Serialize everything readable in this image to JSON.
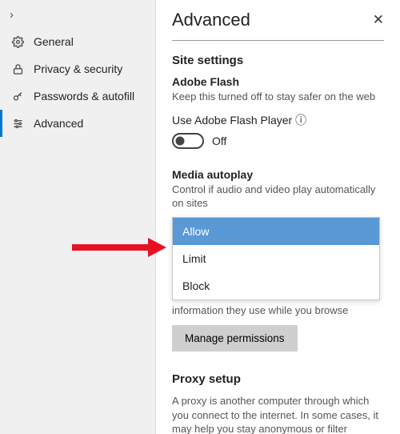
{
  "sidebar": {
    "chevron": "›",
    "items": [
      {
        "label": "General",
        "icon": "gear"
      },
      {
        "label": "Privacy & security",
        "icon": "lock"
      },
      {
        "label": "Passwords & autofill",
        "icon": "key"
      },
      {
        "label": "Advanced",
        "icon": "sliders"
      }
    ]
  },
  "header": {
    "title": "Advanced",
    "close": "✕"
  },
  "site_settings": {
    "title": "Site settings",
    "flash": {
      "label": "Adobe Flash",
      "desc": "Keep this turned off to stay safer on the web",
      "row": "Use Adobe Flash Player ⓘ",
      "toggle_label": "Off"
    },
    "autoplay": {
      "label": "Media autoplay",
      "desc": "Control if audio and video play automatically on sites",
      "options": [
        "Allow",
        "Limit",
        "Block"
      ]
    },
    "cookies_tail": "information they use while you browse",
    "manage_button": "Manage permissions"
  },
  "proxy": {
    "title": "Proxy setup",
    "desc": "A proxy is another computer through which you connect to the internet. In some cases, it may help you stay anonymous or filter"
  }
}
